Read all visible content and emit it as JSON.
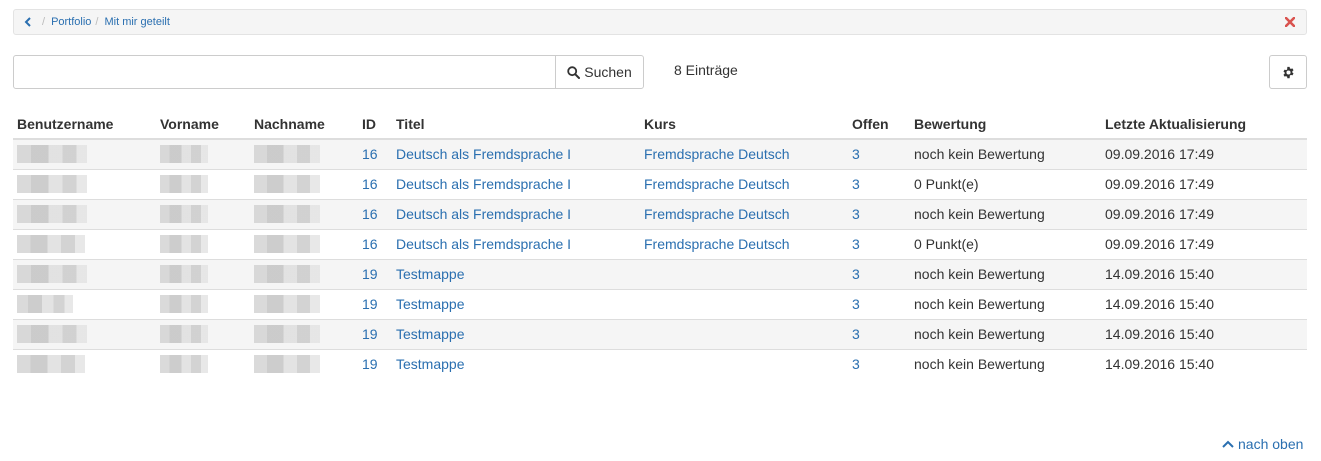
{
  "breadcrumb": {
    "items": [
      "Portfolio",
      "Mit mir geteilt"
    ]
  },
  "toolbar": {
    "search_placeholder": "",
    "search_label": "Suchen",
    "entry_count": "8 Einträge"
  },
  "table": {
    "headers": [
      "Benutzername",
      "Vorname",
      "Nachname",
      "ID",
      "Titel",
      "Kurs",
      "Offen",
      "Bewertung",
      "Letzte Aktualisierung"
    ],
    "rows": [
      {
        "id": "16",
        "title": "Deutsch als Fremdsprache I",
        "course": "Fremdsprache Deutsch",
        "open": "3",
        "rating": "noch kein Bewertung",
        "updated": "09.09.2016 17:49"
      },
      {
        "id": "16",
        "title": "Deutsch als Fremdsprache I",
        "course": "Fremdsprache Deutsch",
        "open": "3",
        "rating": "0 Punkt(e)",
        "updated": "09.09.2016 17:49"
      },
      {
        "id": "16",
        "title": "Deutsch als Fremdsprache I",
        "course": "Fremdsprache Deutsch",
        "open": "3",
        "rating": "noch kein Bewertung",
        "updated": "09.09.2016 17:49"
      },
      {
        "id": "16",
        "title": "Deutsch als Fremdsprache I",
        "course": "Fremdsprache Deutsch",
        "open": "3",
        "rating": "0 Punkt(e)",
        "updated": "09.09.2016 17:49"
      },
      {
        "id": "19",
        "title": "Testmappe",
        "course": "",
        "open": "3",
        "rating": "noch kein Bewertung",
        "updated": "14.09.2016 15:40"
      },
      {
        "id": "19",
        "title": "Testmappe",
        "course": "",
        "open": "3",
        "rating": "noch kein Bewertung",
        "updated": "14.09.2016 15:40"
      },
      {
        "id": "19",
        "title": "Testmappe",
        "course": "",
        "open": "3",
        "rating": "noch kein Bewertung",
        "updated": "14.09.2016 15:40"
      },
      {
        "id": "19",
        "title": "Testmappe",
        "course": "",
        "open": "3",
        "rating": "noch kein Bewertung",
        "updated": "14.09.2016 15:40"
      }
    ]
  },
  "footer": {
    "to_top_label": "nach oben"
  },
  "colors": {
    "link": "#2a6fb0",
    "close": "#d9534f",
    "stripe": "#f5f5f5"
  }
}
